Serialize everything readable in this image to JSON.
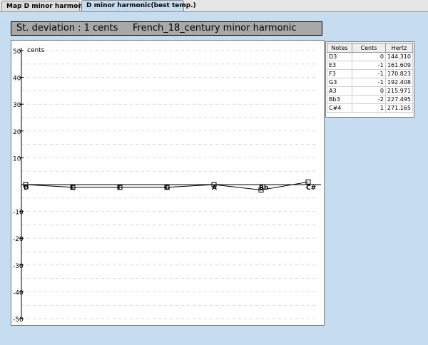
{
  "tabs": [
    {
      "label": "Map D minor harmonic",
      "active": false
    },
    {
      "label": "D minor harmonic(best temp.)",
      "active": true
    }
  ],
  "summary": {
    "deviation": "St. deviation : 1 cents",
    "temperament": "French_18_century minor harmonic"
  },
  "table": {
    "headers": [
      "Notes",
      "Cents",
      "Hertz"
    ],
    "rows": [
      {
        "note": "D3",
        "cents": "0",
        "hertz": "144.310"
      },
      {
        "note": "E3",
        "cents": "-1",
        "hertz": "161.609"
      },
      {
        "note": "F3",
        "cents": "-1",
        "hertz": "170.823"
      },
      {
        "note": "G3",
        "cents": "-1",
        "hertz": "192.408"
      },
      {
        "note": "A3",
        "cents": "0",
        "hertz": "215.971"
      },
      {
        "note": "Bb3",
        "cents": "-2",
        "hertz": "227.495"
      },
      {
        "note": "C#4",
        "cents": "1",
        "hertz": "271.165"
      }
    ]
  },
  "chart_data": {
    "type": "line",
    "ylabel": "cents",
    "ylim": [
      -50,
      50
    ],
    "yticks": [
      50,
      40,
      30,
      20,
      10,
      -10,
      -20,
      -30,
      -40,
      -50
    ],
    "grid": true,
    "categories": [
      "D",
      "E",
      "F",
      "G",
      "A",
      "Bb",
      "C#"
    ],
    "values": [
      0,
      -1,
      -1,
      -1,
      0,
      -2,
      1
    ]
  },
  "colors": {
    "background": "#c6dcf0",
    "title_bar": "#a8a8a8",
    "grid": "#d9d9d9",
    "line": "#000000"
  }
}
